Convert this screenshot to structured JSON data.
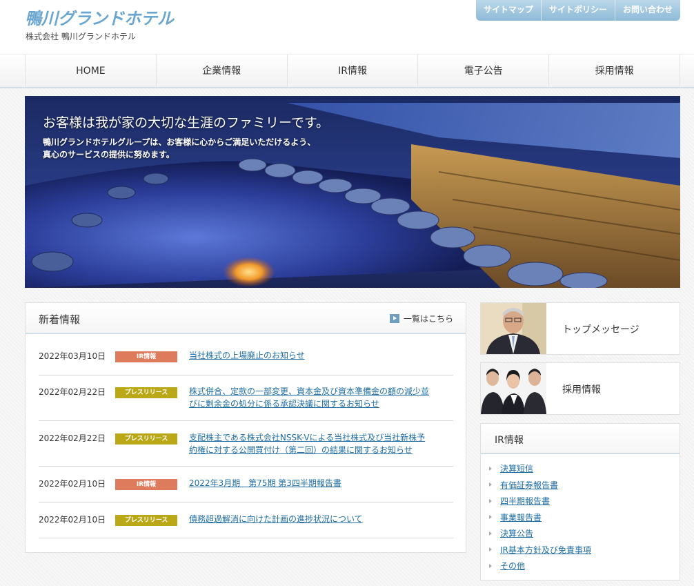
{
  "header": {
    "logo_text": "鴨川グランドホテル",
    "company_name": "株式会社 鴨川グランドホテル",
    "utility_links": [
      "サイトマップ",
      "サイトポリシー",
      "お問い合わせ"
    ]
  },
  "nav": {
    "items": [
      "HOME",
      "企業情報",
      "IR情報",
      "電子公告",
      "採用情報"
    ]
  },
  "hero": {
    "title": "お客様は我が家の大切な生涯のファミリーです。",
    "line1": "鴨川グランドホテルグループは、お客様に心からご満足いただけるよう、",
    "line2": "真心のサービスの提供に努めます。"
  },
  "news": {
    "title": "新着情報",
    "more_label": "一覧はこちら",
    "items": [
      {
        "date": "2022年03月10日",
        "category": "IR情報",
        "category_color": "#de7b5c",
        "text": "当社株式の上場廃止のお知らせ"
      },
      {
        "date": "2022年02月22日",
        "category": "プレスリリース",
        "category_color": "#bba816",
        "line1": "株式併合、定款の一部変更、資本金及び資本準備金の額の減少並",
        "line2": "びに剰余金の処分に係る承認決議に関するお知らせ"
      },
      {
        "date": "2022年02月22日",
        "category": "プレスリリース",
        "category_color": "#bba816",
        "line1": "支配株主である株式会社NSSK-Vによる当社株式及び当社新株予",
        "line2": "約権に対する公開買付け（第二回）の結果に関するお知らせ"
      },
      {
        "date": "2022年02月10日",
        "category": "IR情報",
        "category_color": "#de7b5c",
        "text": "2022年3月期　第75期 第3四半期報告書"
      },
      {
        "date": "2022年02月10日",
        "category": "プレスリリース",
        "category_color": "#bba816",
        "text": "債務超過解消に向けた計画の進捗状況について"
      }
    ]
  },
  "side": {
    "top_message": "トップメッセージ",
    "recruit": "採用情報",
    "ir_title": "IR情報",
    "ir_links": [
      "決算短信",
      "有価証券報告書",
      "四半期報告書",
      "事業報告書",
      "決算公告",
      "IR基本方針及び免責事項",
      "その他"
    ]
  },
  "colors": {
    "accent": "#8db9d6",
    "link": "#1f6ea3",
    "ir_badge": "#de7b5c",
    "press_badge": "#bba816"
  }
}
